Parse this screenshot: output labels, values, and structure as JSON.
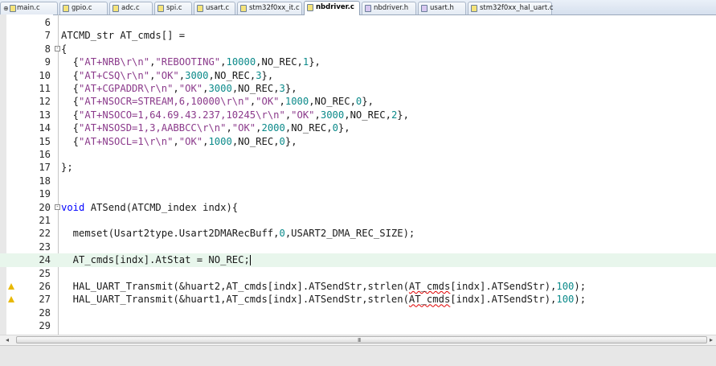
{
  "tabs": [
    {
      "label": "main.c",
      "type": "c"
    },
    {
      "label": "gpio.c",
      "type": "c"
    },
    {
      "label": "adc.c",
      "type": "c"
    },
    {
      "label": "spi.c",
      "type": "c"
    },
    {
      "label": "usart.c",
      "type": "c"
    },
    {
      "label": "stm32f0xx_it.c",
      "type": "c"
    },
    {
      "label": "nbdriver.c",
      "type": "c",
      "active": true
    },
    {
      "label": "nbdriver.h",
      "type": "h"
    },
    {
      "label": "usart.h",
      "type": "h"
    },
    {
      "label": "stm32f0xx_hal_uart.c",
      "type": "c"
    }
  ],
  "editor": {
    "current_line": 24,
    "warning_lines": [
      26,
      27
    ],
    "fold_lines": {
      "8": "-",
      "20": "-"
    },
    "lines": [
      {
        "n": "6",
        "code": ""
      },
      {
        "n": "7",
        "code": "ATCMD_str AT_cmds[] ="
      },
      {
        "n": "8",
        "code": "{"
      },
      {
        "n": "9",
        "code": "  {\"AT+NRB\\r\\n\",\"REBOOTING\",10000,NO_REC,1},"
      },
      {
        "n": "10",
        "code": "  {\"AT+CSQ\\r\\n\",\"OK\",3000,NO_REC,3},"
      },
      {
        "n": "11",
        "code": "  {\"AT+CGPADDR\\r\\n\",\"OK\",3000,NO_REC,3},"
      },
      {
        "n": "12",
        "code": "  {\"AT+NSOCR=STREAM,6,10000\\r\\n\",\"OK\",1000,NO_REC,0},"
      },
      {
        "n": "13",
        "code": "  {\"AT+NSOCO=1,64.69.43.237,10245\\r\\n\",\"OK\",3000,NO_REC,2},"
      },
      {
        "n": "14",
        "code": "  {\"AT+NSOSD=1,3,AABBCC\\r\\n\",\"OK\",2000,NO_REC,0},"
      },
      {
        "n": "15",
        "code": "  {\"AT+NSOCL=1\\r\\n\",\"OK\",1000,NO_REC,0},"
      },
      {
        "n": "16",
        "code": ""
      },
      {
        "n": "17",
        "code": "};"
      },
      {
        "n": "18",
        "code": ""
      },
      {
        "n": "19",
        "code": ""
      },
      {
        "n": "20",
        "code": "void ATSend(ATCMD_index indx){"
      },
      {
        "n": "21",
        "code": ""
      },
      {
        "n": "22",
        "code": "  memset(Usart2type.Usart2DMARecBuff,0,USART2_DMA_REC_SIZE);"
      },
      {
        "n": "23",
        "code": ""
      },
      {
        "n": "24",
        "code": "  AT_cmds[indx].AtStat = NO_REC;"
      },
      {
        "n": "25",
        "code": ""
      },
      {
        "n": "26",
        "code": "  HAL_UART_Transmit(&huart2,AT_cmds[indx].ATSendStr,strlen(AT_cmds[indx].ATSendStr),100);"
      },
      {
        "n": "27",
        "code": "  HAL_UART_Transmit(&huart1,AT_cmds[indx].ATSendStr,strlen(AT_cmds[indx].ATSendStr),100);"
      },
      {
        "n": "28",
        "code": ""
      },
      {
        "n": "29",
        "code": ""
      }
    ]
  },
  "scrollbar": {
    "grip": "III"
  },
  "colors": {
    "keyword": "#0000ff",
    "string": "#8b3a8b",
    "number": "#0b8a8a",
    "current_line": "#e8f6ec",
    "warning": "#e8b800"
  }
}
